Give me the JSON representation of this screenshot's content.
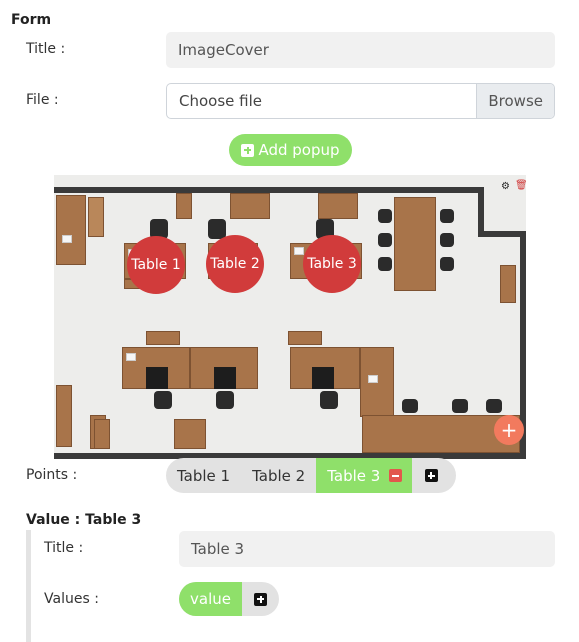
{
  "form": {
    "heading": "Form",
    "title_label": "Title :",
    "title_value": "ImageCover",
    "file_label": "File :",
    "file_placeholder": "Choose file",
    "browse_label": "Browse",
    "add_popup_label": "Add popup"
  },
  "image": {
    "points": [
      "Table 1",
      "Table 2",
      "Table 3"
    ],
    "settings_icon": "gear-icon",
    "delete_icon": "trash-icon",
    "add_point_icon": "plus-icon"
  },
  "points": {
    "label": "Points :",
    "items": [
      "Table 1",
      "Table 2",
      "Table 3"
    ],
    "active": "Table 3"
  },
  "value_section": {
    "heading": "Value : Table 3",
    "title_label": "Title :",
    "title_value": "Table 3",
    "values_label": "Values :",
    "values": [
      "value"
    ]
  },
  "colors": {
    "accent_green": "#8fe06a",
    "point_red": "#d13b3b",
    "fab_orange": "#f27a5e"
  }
}
